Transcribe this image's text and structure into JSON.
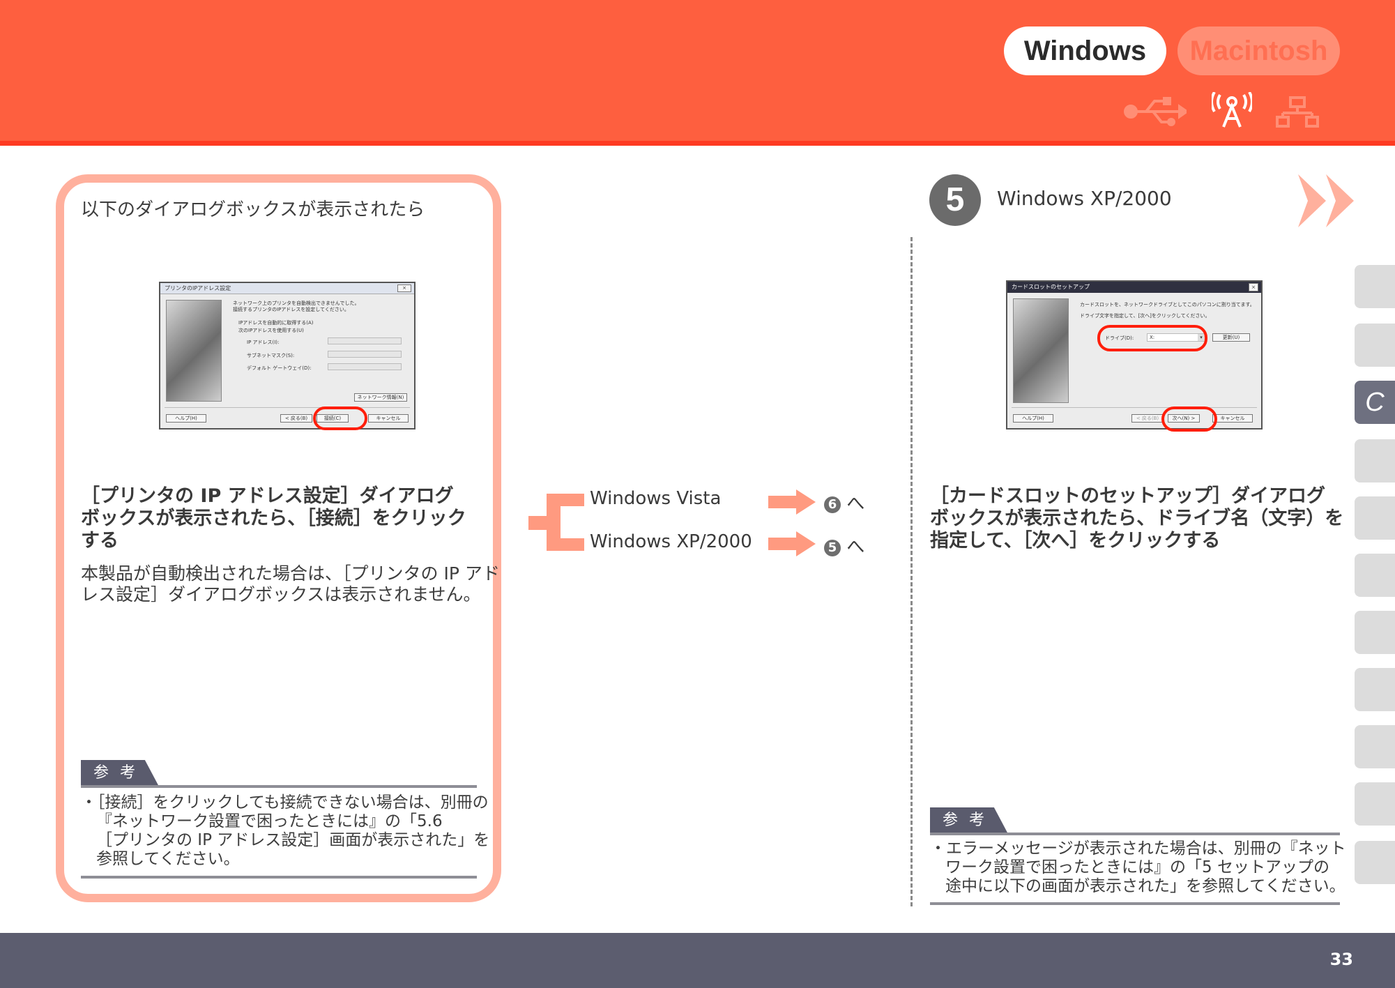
{
  "header": {
    "os_tabs": {
      "windows": "Windows",
      "macintosh": "Macintosh"
    },
    "connection_icons": [
      "usb-icon",
      "wireless-icon",
      "wired-lan-icon"
    ],
    "colors": {
      "bar": "#fe5f3f",
      "underline": "#fe3a22"
    }
  },
  "left": {
    "intro": "以下のダイアログボックスが表示されたら",
    "dialog": {
      "title": "プリンタのIPアドレス設定",
      "message_1": "ネットワーク上のプリンタを自動検出できませんでした。",
      "message_2": "接続するプリンタのIPアドレスを設定してください。",
      "option_auto": "IPアドレスを自動的に取得する(A)",
      "option_manual": "次のIPアドレスを使用する(U)",
      "field_ip": "IP アドレス(I):",
      "field_subnet": "サブネットマスク(S):",
      "field_gateway": "デフォルト ゲートウェイ(D):",
      "btn_network_info": "ネットワーク情報(N)",
      "btn_help": "ヘルプ(H)",
      "btn_back": "< 戻る(B)",
      "btn_connect": "接続(C)",
      "btn_cancel": "キャンセル"
    },
    "heading": [
      "［プリンタの IP アドレス設定］ダイアログ",
      "ボックスが表示されたら、［接続］をクリック",
      "する"
    ],
    "body": [
      "本製品が自動検出された場合は、［プリンタの IP アド",
      "レス設定］ダイアログボックスは表示されません。"
    ],
    "reference": {
      "tab": "参考",
      "text": [
        "・［接続］をクリックしても接続できない場合は、別冊の",
        "『ネットワーク設置で困ったときには』の「5.6",
        "［プリンタの IP アドレス設定］画面が表示された」を",
        "参照してください。"
      ]
    }
  },
  "middle": {
    "branches": [
      {
        "label": "Windows Vista",
        "step": "6",
        "suffix": "へ"
      },
      {
        "label": "Windows XP/2000",
        "step": "5",
        "suffix": "へ"
      }
    ]
  },
  "right": {
    "step_number": "5",
    "step_title": "Windows XP/2000",
    "dialog": {
      "title": "カードスロットのセットアップ",
      "message_1": "カードスロットを、ネットワークドライブとしてこのパソコンに割り当てます。",
      "message_2": "ドライブ文字を指定して、[次へ]をクリックしてください。",
      "drive_label": "ドライブ(D):",
      "drive_value": "X:",
      "btn_refresh": "更新(U)",
      "btn_help": "ヘルプ(H)",
      "btn_back": "< 戻る(B)",
      "btn_next": "次へ(N) >",
      "btn_cancel": "キャンセル"
    },
    "heading": [
      "［カードスロットのセットアップ］ダイアログ",
      "ボックスが表示されたら、ドライブ名（文字）を",
      "指定して、［次へ］をクリックする"
    ],
    "reference": {
      "tab": "参考",
      "text": [
        "・エラーメッセージが表示された場合は、別冊の『ネット",
        "ワーク設置で困ったときには』の「5 セットアップの",
        "途中に以下の画面が表示された」を参照してください。"
      ]
    }
  },
  "side_tabs": {
    "active_label": "C"
  },
  "footer": {
    "page_number": "33"
  }
}
